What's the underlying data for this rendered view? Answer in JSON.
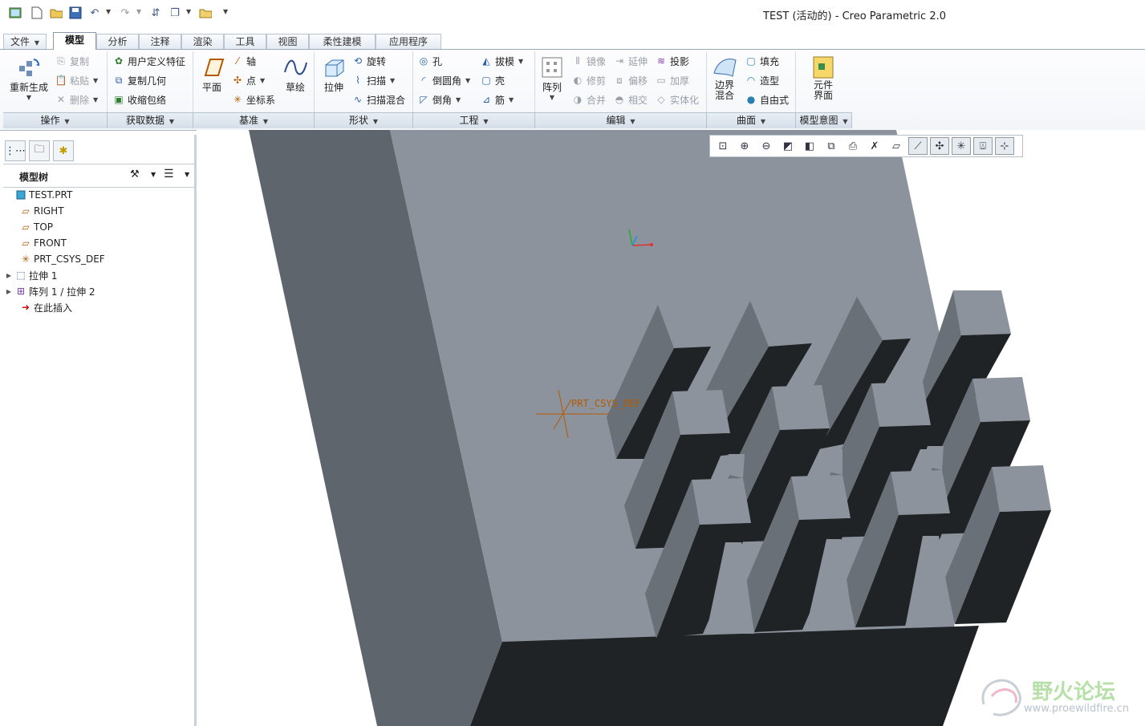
{
  "window": {
    "title": "TEST (活动的) - Creo Parametric 2.0"
  },
  "quick_access": {
    "icons": [
      "app-icon",
      "new-icon",
      "open-icon",
      "save-icon",
      "undo-icon",
      "redo-icon",
      "regenerate-icon",
      "windows-icon",
      "close-window-icon",
      "customize-icon"
    ]
  },
  "tabs": [
    {
      "label": "文件"
    },
    {
      "label": "模型",
      "active": true
    },
    {
      "label": "分析"
    },
    {
      "label": "注释"
    },
    {
      "label": "渲染"
    },
    {
      "label": "工具"
    },
    {
      "label": "视图"
    },
    {
      "label": "柔性建模"
    },
    {
      "label": "应用程序"
    }
  ],
  "ribbon": {
    "operations": {
      "regenerate": "重新生成",
      "copy": "复制",
      "paste": "粘贴",
      "delete": "删除",
      "footer": "操作"
    },
    "get_data": {
      "udf": "用户定义特征",
      "copy_geom": "复制几何",
      "shrinkwrap": "收缩包络",
      "footer": "获取数据"
    },
    "datum": {
      "plane": "平面",
      "axis": "轴",
      "point": "点",
      "csys": "坐标系",
      "sketch": "草绘",
      "footer": "基准"
    },
    "shapes": {
      "extrude": "拉伸",
      "revolve": "旋转",
      "sweep": "扫描",
      "swept_blend": "扫描混合",
      "footer": "形状"
    },
    "engineering": {
      "hole": "孔",
      "round": "倒圆角",
      "chamfer": "倒角",
      "draft": "拔模",
      "shell": "壳",
      "rib": "筋",
      "footer": "工程"
    },
    "editing": {
      "pattern": "阵列",
      "mirror": "镜像",
      "trim": "修剪",
      "merge": "合并",
      "extend": "延伸",
      "offset": "偏移",
      "intersect": "相交",
      "project": "投影",
      "thicken": "加厚",
      "solidify": "实体化",
      "footer": "编辑"
    },
    "surfaces": {
      "boundary_blend_1": "边界",
      "boundary_blend_2": "混合",
      "fill": "填充",
      "style": "造型",
      "freestyle": "自由式",
      "footer": "曲面"
    },
    "model_intent": {
      "component_interface_1": "元件",
      "component_interface_2": "界面",
      "footer": "模型意图"
    }
  },
  "model_tree": {
    "title": "模型树",
    "items": [
      {
        "label": "TEST.PRT",
        "icon": "part-icon",
        "expandable": false
      },
      {
        "label": "RIGHT",
        "icon": "datum-plane-icon",
        "expandable": false
      },
      {
        "label": "TOP",
        "icon": "datum-plane-icon",
        "expandable": false
      },
      {
        "label": "FRONT",
        "icon": "datum-plane-icon",
        "expandable": false
      },
      {
        "label": "PRT_CSYS_DEF",
        "icon": "csys-icon",
        "expandable": false
      },
      {
        "label": "拉伸 1",
        "icon": "extrude-icon",
        "expandable": true
      },
      {
        "label": "阵列 1 / 拉伸 2",
        "icon": "pattern-icon",
        "expandable": true
      },
      {
        "label": "在此插入",
        "icon": "insert-here-arrow-icon",
        "expandable": false
      }
    ]
  },
  "viewport": {
    "csys_label": "PRT_CSYS_DEF",
    "watermark_title": "野火论坛",
    "watermark_url": "www.proewildfire.cn",
    "colors": {
      "top_face": "#8d939c",
      "left_face": "#5f656c",
      "dark_face": "#202325",
      "rib_side": "#6a7077",
      "rib_top": "#8d939c"
    }
  },
  "graphics_toolbar": {
    "icons": [
      "refit-icon",
      "zoom-in-icon",
      "zoom-out-icon",
      "repaint-icon",
      "display-style-icon",
      "saved-orientations-icon",
      "view-manager-icon",
      "datum-display-icon",
      "plane-display-icon",
      "axis-display-icon",
      "point-display-icon",
      "csys-display-icon",
      "annotation-display-icon",
      "spin-center-icon"
    ]
  },
  "left_panel_tabs": [
    "model-tree-tab-icon",
    "folder-browser-tab-icon",
    "favorites-tab-icon"
  ]
}
